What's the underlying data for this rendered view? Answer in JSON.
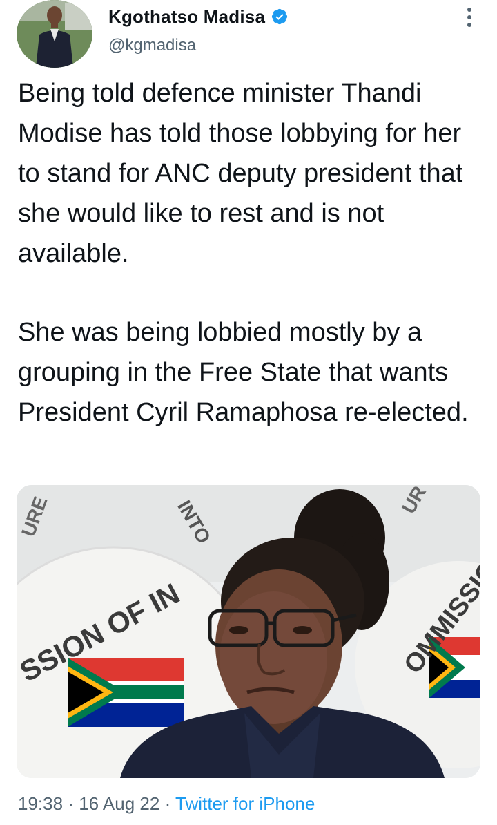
{
  "author": {
    "name": "Kgothatso Madisa",
    "handle": "@kgmadisa",
    "verified": true
  },
  "tweet": {
    "paragraphs": [
      "Being told defence minister Thandi Modise has told those lobbying for her to stand for ANC deputy president that she would like to rest and is not available.",
      "She was being lobbied mostly by a grouping in the Free State that wants President Cyril Ramaphosa re-elected."
    ]
  },
  "media": {
    "backdrop_text_left": "SSION OF IN",
    "backdrop_text_right": "OMMISSION",
    "backdrop_text_top": "INTO",
    "backdrop_text_top_left": "URE",
    "backdrop_text_top_right": "UR"
  },
  "meta": {
    "time": "19:38",
    "separator": "·",
    "date": "16 Aug 22",
    "source": "Twitter for iPhone"
  },
  "colors": {
    "accent": "#1d9bf0",
    "secondary_text": "#536471",
    "primary_text": "#0f1419"
  },
  "icons": {
    "verified": "verified-badge-icon",
    "more": "more-options-icon"
  }
}
